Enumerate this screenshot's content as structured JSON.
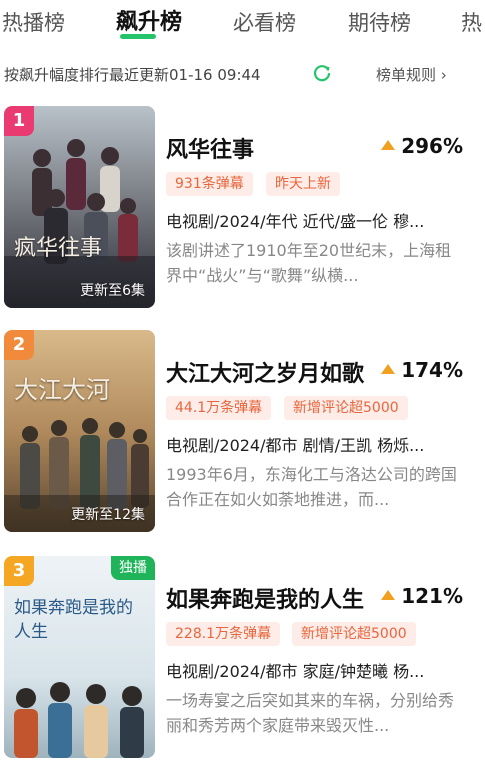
{
  "tabs": [
    {
      "label": "热播榜"
    },
    {
      "label": "飙升榜"
    },
    {
      "label": "必看榜"
    },
    {
      "label": "期待榜"
    },
    {
      "label": "热"
    }
  ],
  "subbar": {
    "update_text": "按飙升幅度排行最近更新01-16 09:44",
    "rules_link": "榜单规则 ›"
  },
  "colors": {
    "accent_green": "#25c46b",
    "rank_1": "#e93b72",
    "rank_2": "#f28a3c",
    "rank_3": "#f5a623",
    "tag_bg": "#fdece7",
    "tag_text": "#e8663d",
    "rise_arrow": "#f2a020"
  },
  "items": [
    {
      "rank": "1",
      "poster_art": "疯华往事",
      "poster_caption": "更新至6集",
      "title": "风华往事",
      "rise": "296%",
      "tags": [
        "931条弹幕",
        "昨天上新"
      ],
      "meta": "电视剧/2024/年代 近代/盛一伦 穆...",
      "desc": "该剧讲述了1910年至20世纪末，上海租界中“战火”与“歌舞”纵横..."
    },
    {
      "rank": "2",
      "poster_art": "大江大河",
      "poster_caption": "更新至12集",
      "title": "大江大河之岁月如歌",
      "rise": "174%",
      "tags": [
        "44.1万条弹幕",
        "新增评论超5000"
      ],
      "meta": "电视剧/2024/都市 剧情/王凯 杨烁...",
      "desc": "1993年6月，东海化工与洛达公司的跨国合作正在如火如荼地推进，而..."
    },
    {
      "rank": "3",
      "badge": "独播",
      "poster_art": "如果奔跑是我的人生",
      "title": "如果奔跑是我的人生",
      "rise": "121%",
      "tags": [
        "228.1万条弹幕",
        "新增评论超5000"
      ],
      "meta": "电视剧/2024/都市 家庭/钟楚曦 杨...",
      "desc": "一场寿宴之后突如其来的车祸，分别给秀丽和秀芳两个家庭带来毁灭性..."
    }
  ]
}
